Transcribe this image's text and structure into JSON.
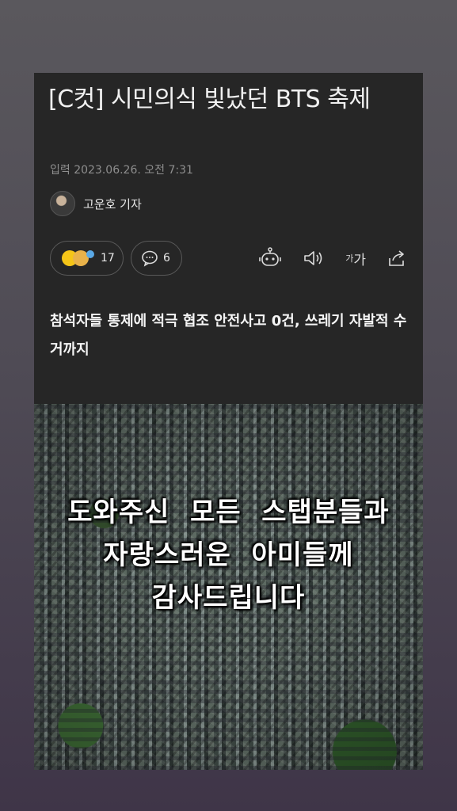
{
  "article": {
    "title": "[C컷] 시민의식 빛났던 BTS 축제",
    "date": "입력 2023.06.26. 오전 7:31",
    "author": "고운호 기자",
    "reactions_count": "17",
    "comments_count": "6",
    "font_size_label_small": "가",
    "font_size_label_large": "가",
    "subtitle": "참석자들 통제에 적극 협조 안전사고 0건, 쓰레기 자발적 수거까지"
  },
  "photo": {
    "overlay_text": "도와주신  모든  스탭분들과\n자랑스러운  아미들께\n감사드립니다"
  },
  "icons": {
    "reaction": "emoji-reactions-icon",
    "comment": "comment-bubble-icon",
    "bot": "robot-summary-icon",
    "audio": "speaker-icon",
    "share": "share-icon"
  }
}
